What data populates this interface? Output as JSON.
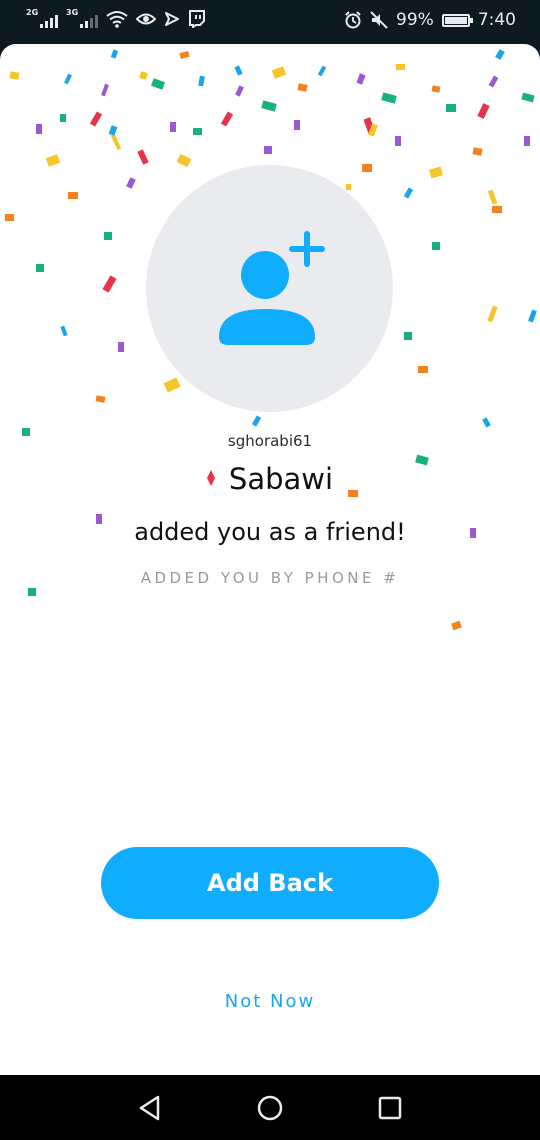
{
  "status_bar": {
    "signal_1_label": "2G",
    "signal_2_label": "3G",
    "battery_percent": "99%",
    "time": "7:40",
    "icons": [
      "wifi-icon",
      "eye-icon",
      "send-icon",
      "twitch-icon",
      "alarm-icon",
      "mute-icon",
      "battery-icon"
    ]
  },
  "profile": {
    "username": "sghorabi61",
    "display_name": "Sabawi",
    "message": "added you as a friend!",
    "source": "ADDED YOU BY PHONE #",
    "avatar_icon": "add-friend-icon"
  },
  "actions": {
    "add_back_label": "Add Back",
    "not_now_label": "Not Now"
  },
  "nav_bar": {
    "buttons": [
      "back-icon",
      "home-icon",
      "recents-icon"
    ]
  },
  "colors": {
    "accent": "#10adff",
    "link": "#1aa5ea",
    "avatar_bg": "#e9ebee",
    "diamond": "#e8324a",
    "confetti": [
      "#1aa5ea",
      "#9b59d0",
      "#f6c528",
      "#18b07f",
      "#f5821f",
      "#e8324a"
    ]
  }
}
